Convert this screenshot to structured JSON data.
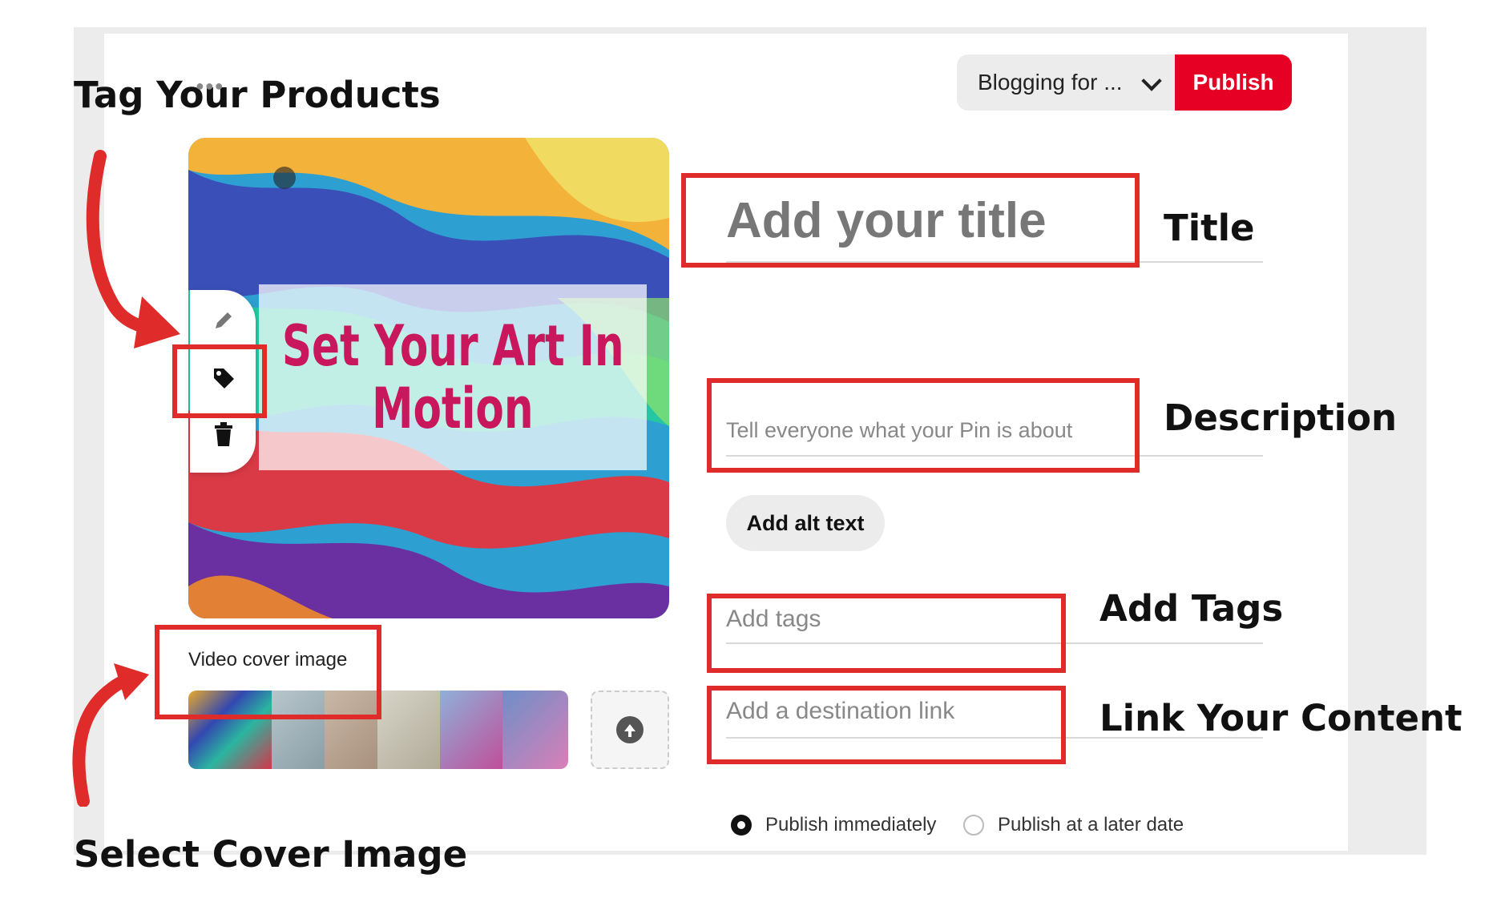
{
  "annotations": {
    "tag_products": "Tag Your Products",
    "title": "Title",
    "description": "Description",
    "add_tags": "Add Tags",
    "link_content": "Link Your Content",
    "select_cover": "Select Cover Image"
  },
  "header": {
    "board_select_value": "Blogging for ...",
    "publish_label": "Publish"
  },
  "pin": {
    "overlay_line1": "Set Your Art In",
    "overlay_line2": "Motion",
    "tools": [
      "pencil-icon",
      "tag-icon",
      "trash-icon"
    ],
    "more_icon": "more-dots-icon",
    "video_cover_label": "Video cover image"
  },
  "form": {
    "title_placeholder": "Add your title",
    "description_placeholder": "Tell everyone what your Pin is about",
    "alt_text_button": "Add alt text",
    "tags_placeholder": "Add tags",
    "link_placeholder": "Add a destination link"
  },
  "publish_options": {
    "immediately": "Publish immediately",
    "later": "Publish at a later date",
    "selected": "immediately"
  },
  "colors": {
    "brand_red": "#e60023",
    "annotation_red": "#e02b2b",
    "overlay_text": "#c8175d"
  }
}
